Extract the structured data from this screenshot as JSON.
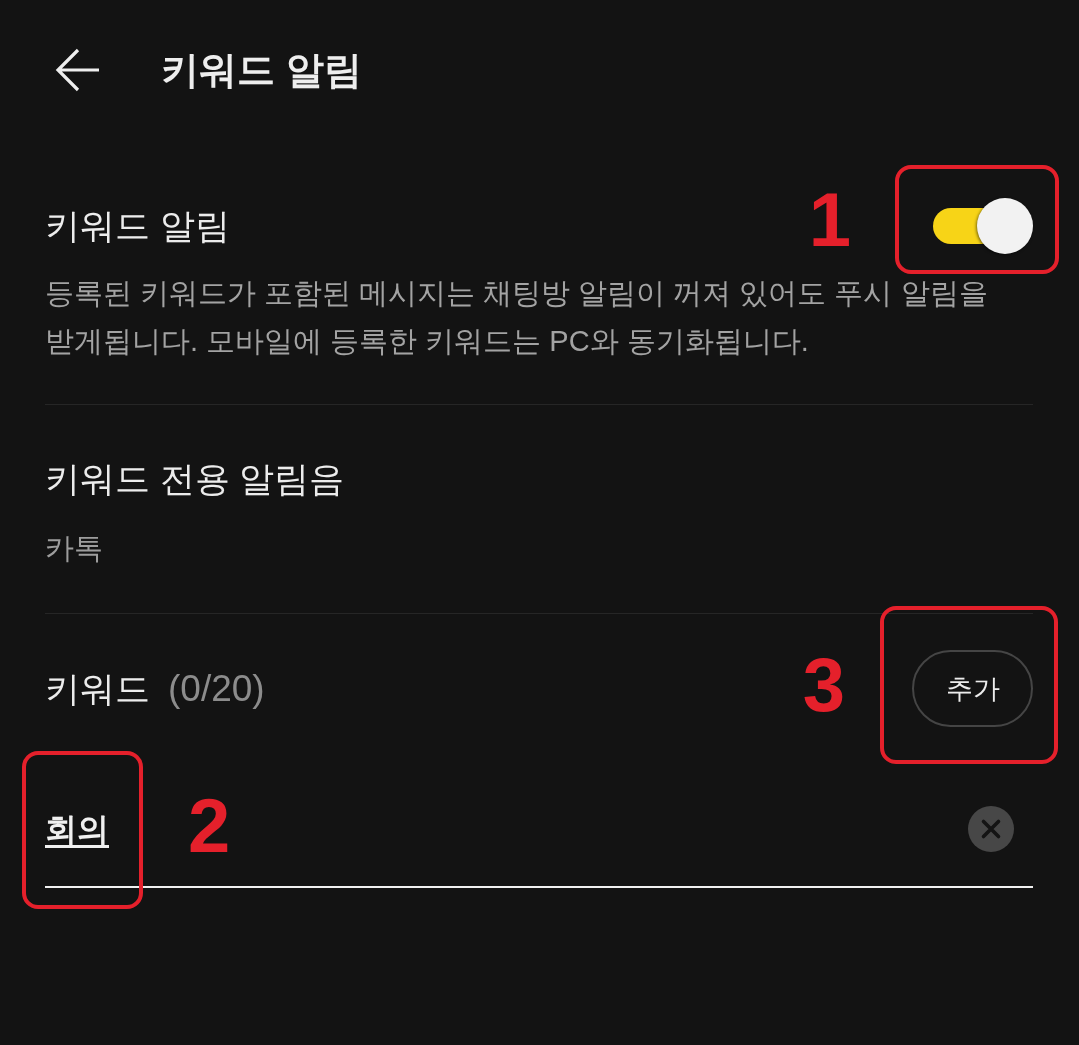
{
  "header": {
    "title": "키워드 알림"
  },
  "keyword_alert": {
    "title": "키워드 알림",
    "on": true,
    "annotation": "1",
    "description": "등록된 키워드가 포함된 메시지는 채팅방 알림이 꺼져 있어도 푸시 알림을 받게됩니다. 모바일에 등록한 키워드는 PC와 동기화됩니다."
  },
  "alert_sound": {
    "title": "키워드 전용 알림음",
    "value": "카톡"
  },
  "keywords": {
    "title": "키워드",
    "count": "(0/20)",
    "add_button": {
      "label": "추가",
      "annotation": "3"
    },
    "input": {
      "value": "회의",
      "annotation": "2"
    }
  }
}
